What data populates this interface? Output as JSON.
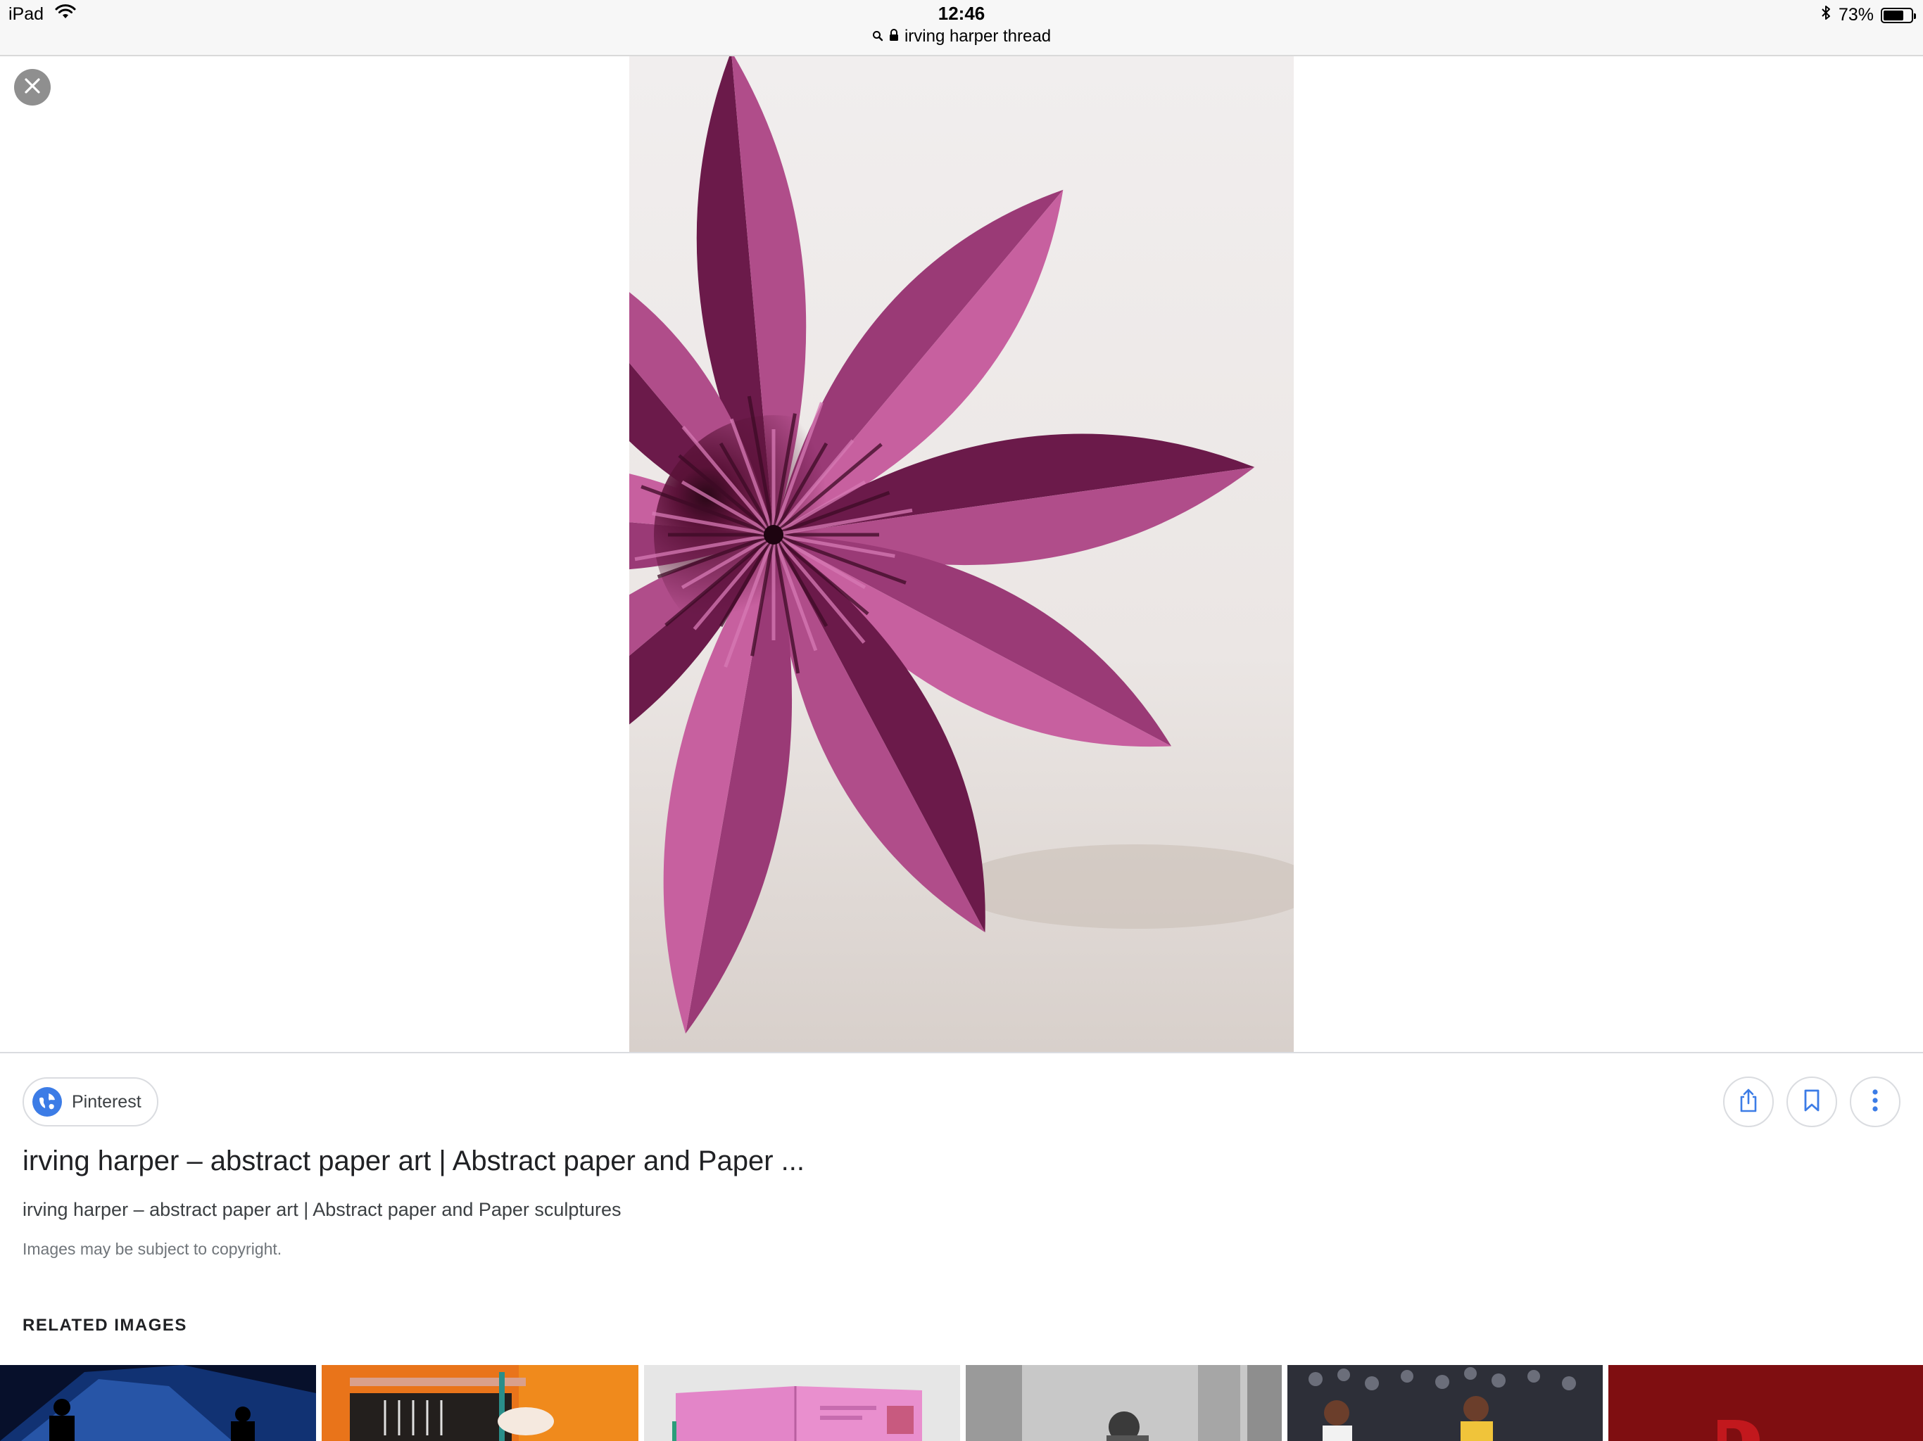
{
  "status_bar": {
    "device": "iPad",
    "time": "12:46",
    "url": "irving harper thread",
    "battery_percent": "73%",
    "battery_level": 0.73
  },
  "icons": {
    "wifi": "wifi-icon",
    "search": "search-icon",
    "lock": "lock-icon",
    "bluetooth": "bluetooth-icon",
    "battery": "battery-icon",
    "close": "close-icon",
    "globe": "globe-icon",
    "share": "share-icon",
    "bookmark": "bookmark-icon",
    "more": "more-vertical-icon"
  },
  "source": {
    "label": "Pinterest"
  },
  "result": {
    "title": "irving harper – abstract paper art | Abstract paper and Paper ...",
    "subtitle": "irving harper – abstract paper art | Abstract paper and Paper sculptures",
    "copyright": "Images may be subject to copyright."
  },
  "related": {
    "heading": "RELATED IMAGES",
    "thumbnails": [
      "concert-thumbnail",
      "orange-room-thumbnail",
      "pink-book-thumbnail",
      "monochrome-portrait-thumbnail",
      "basketball-thumbnail",
      "red-letter-thumbnail"
    ]
  },
  "colors": {
    "accent": "#3c7ce6",
    "petal_light": "#c7609f",
    "petal_dark": "#6b1a4a",
    "close_button": "#8f8f8f"
  }
}
